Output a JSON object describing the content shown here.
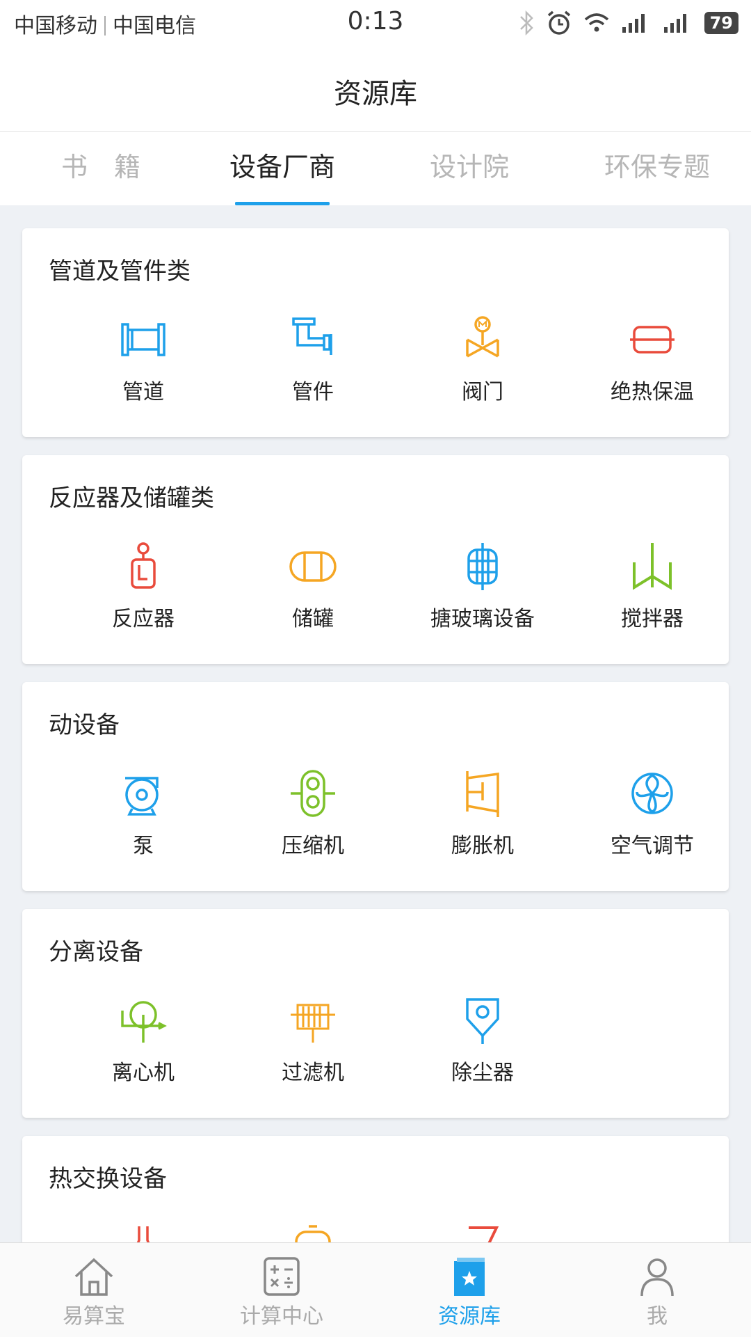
{
  "status": {
    "carrier1": "中国移动",
    "carrier2": "中国电信",
    "time": "0:13",
    "battery": "79"
  },
  "header": {
    "title": "资源库"
  },
  "tabs": [
    {
      "label": "书　籍"
    },
    {
      "label": "设备厂商",
      "active": true
    },
    {
      "label": "设计院"
    },
    {
      "label": "环保专题"
    }
  ],
  "categories": [
    {
      "title": "管道及管件类",
      "items": [
        {
          "label": "管道",
          "icon": "pipe-icon",
          "color": "#1ea0ea"
        },
        {
          "label": "管件",
          "icon": "pipe-fitting-icon",
          "color": "#1ea0ea"
        },
        {
          "label": "阀门",
          "icon": "valve-icon",
          "color": "#f5a623"
        },
        {
          "label": "绝热保温",
          "icon": "insulation-icon",
          "color": "#e94b3c"
        }
      ]
    },
    {
      "title": "反应器及储罐类",
      "items": [
        {
          "label": "反应器",
          "icon": "reactor-icon",
          "color": "#e94b3c"
        },
        {
          "label": "储罐",
          "icon": "tank-icon",
          "color": "#f5a623"
        },
        {
          "label": "搪玻璃设备",
          "icon": "glass-lined-icon",
          "color": "#1ea0ea"
        },
        {
          "label": "搅拌器",
          "icon": "agitator-icon",
          "color": "#7dc12a"
        }
      ]
    },
    {
      "title": "动设备",
      "items": [
        {
          "label": "泵",
          "icon": "pump-icon",
          "color": "#1ea0ea"
        },
        {
          "label": "压缩机",
          "icon": "compressor-icon",
          "color": "#7dc12a"
        },
        {
          "label": "膨胀机",
          "icon": "expander-icon",
          "color": "#f5a623"
        },
        {
          "label": "空气调节",
          "icon": "fan-icon",
          "color": "#1ea0ea"
        }
      ]
    },
    {
      "title": "分离设备",
      "items": [
        {
          "label": "离心机",
          "icon": "centrifuge-icon",
          "color": "#7dc12a"
        },
        {
          "label": "过滤机",
          "icon": "filter-icon",
          "color": "#f5a623"
        },
        {
          "label": "除尘器",
          "icon": "dust-collector-icon",
          "color": "#1ea0ea"
        }
      ]
    },
    {
      "title": "热交换设备",
      "items": [
        {
          "label": "",
          "icon": "heat-exchanger-icon",
          "color": "#e94b3c"
        },
        {
          "label": "",
          "icon": "heater-icon",
          "color": "#f5a623"
        },
        {
          "label": "",
          "icon": "cooler-icon",
          "color": "#e94b3c"
        }
      ]
    }
  ],
  "bottom_nav": [
    {
      "label": "易算宝",
      "icon": "home-icon"
    },
    {
      "label": "计算中心",
      "icon": "calculator-icon"
    },
    {
      "label": "资源库",
      "icon": "library-icon",
      "active": true
    },
    {
      "label": "我",
      "icon": "profile-icon"
    }
  ]
}
